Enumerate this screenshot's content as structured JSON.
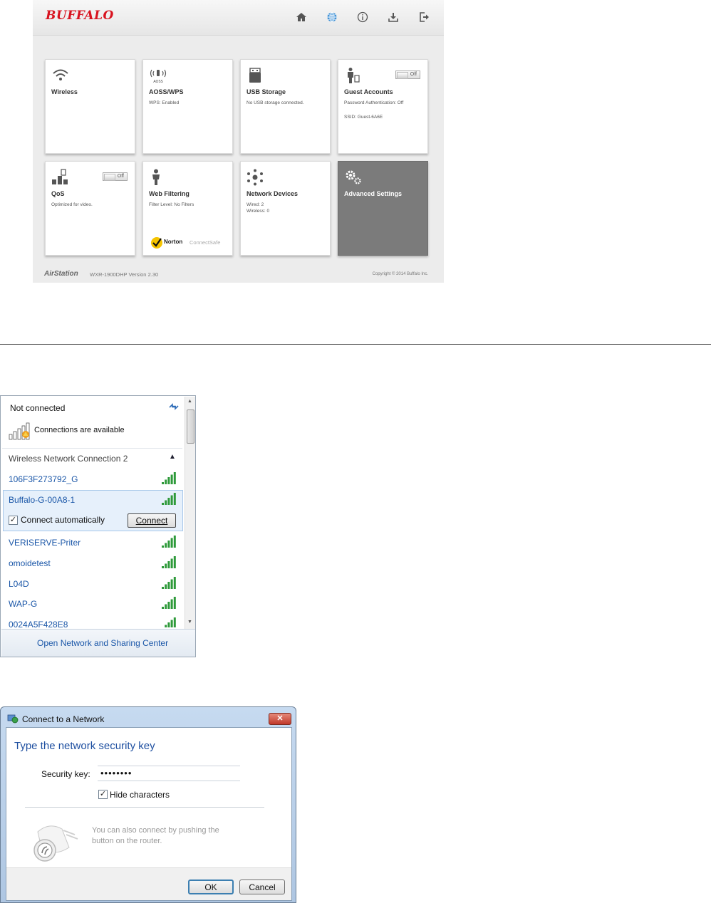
{
  "router": {
    "logo": "BUFFALO",
    "nav_icons": [
      "home-icon",
      "globe-icon",
      "info-icon",
      "download-icon",
      "logout-icon"
    ],
    "tiles": [
      {
        "title": "Wireless",
        "icon": "wifi-icon",
        "lines": []
      },
      {
        "title": "AOSS/WPS",
        "icon": "aoss-icon",
        "icon_label": "AOSS",
        "lines": [
          "WPS: Enabled"
        ]
      },
      {
        "title": "USB Storage",
        "icon": "usb-icon",
        "lines": [
          "No USB storage connected."
        ]
      },
      {
        "title": "Guest Accounts",
        "icon": "guest-icon",
        "toggle": "Off",
        "lines": [
          "Password Authentication: Off",
          "SSID: Guest-6A6E"
        ]
      },
      {
        "title": "QoS",
        "icon": "qos-icon",
        "toggle": "Off",
        "lines": [
          "Optimized for video."
        ]
      },
      {
        "title": "Web Filtering",
        "icon": "person-icon",
        "lines": [
          "Filter Level: No Filters"
        ],
        "norton": "Norton",
        "connectsafe": "ConnectSafe"
      },
      {
        "title": "Network Devices",
        "icon": "network-icon",
        "lines": [
          "Wired: 2",
          "Wireless: 0"
        ]
      },
      {
        "title": "Advanced Settings",
        "icon": "gears-icon",
        "lines": []
      }
    ],
    "footer": {
      "brand": "AirStation",
      "model": "WXR-1900DHP   Version 2.30",
      "copyright": "Copyright © 2014 Buffalo Inc."
    }
  },
  "flyout": {
    "status": "Not connected",
    "available": "Connections are available",
    "group": "Wireless Network Connection 2",
    "networks": [
      "106F3F273792_G",
      "Buffalo-G-00A8-1",
      "VERISERVE-Priter",
      "omoidetest",
      "L04D",
      "WAP-G",
      "0024A5F428E8"
    ],
    "connect_auto": "Connect automatically",
    "connect_button": "Connect",
    "footer_link": "Open Network and Sharing Center"
  },
  "dialog": {
    "title": "Connect to a Network",
    "heading": "Type the network security key",
    "key_label": "Security key:",
    "key_value": "••••••••",
    "hide_label": "Hide characters",
    "hint": "You can also connect by pushing the button on the router.",
    "ok": "OK",
    "cancel": "Cancel"
  },
  "colors": {
    "brand_red": "#d8131f",
    "link_blue": "#1b57a8",
    "dark_tile": "#7b7b7b",
    "signal_green": "#2e9a3a"
  }
}
